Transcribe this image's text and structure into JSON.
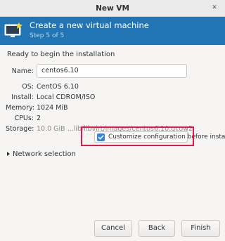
{
  "window": {
    "title": "New VM"
  },
  "banner": {
    "title": "Create a new virtual machine",
    "subtitle": "Step 5 of 5",
    "icon": "monitor-icon"
  },
  "heading": "Ready to begin the installation",
  "fields": {
    "name": {
      "label": "Name:",
      "value": "centos6.10"
    },
    "os": {
      "label": "OS:",
      "value": "CentOS 6.10"
    },
    "install": {
      "label": "Install:",
      "value": "Local CDROM/ISO"
    },
    "memory": {
      "label": "Memory:",
      "value": "1024 MiB"
    },
    "cpus": {
      "label": "CPUs:",
      "value": "2"
    },
    "storage": {
      "label": "Storage:",
      "value": "10.0 GiB ...lib/libvirt/images/centos6.10.qcow2"
    }
  },
  "customize": {
    "label": "Customize configuration before install",
    "checked": true
  },
  "network": {
    "label": "Network selection",
    "expanded": false
  },
  "buttons": {
    "cancel": "Cancel",
    "back": "Back",
    "finish": "Finish"
  },
  "colors": {
    "banner": "#2175b4",
    "highlight": "#e5174c",
    "checkbox": "#3584e4"
  }
}
